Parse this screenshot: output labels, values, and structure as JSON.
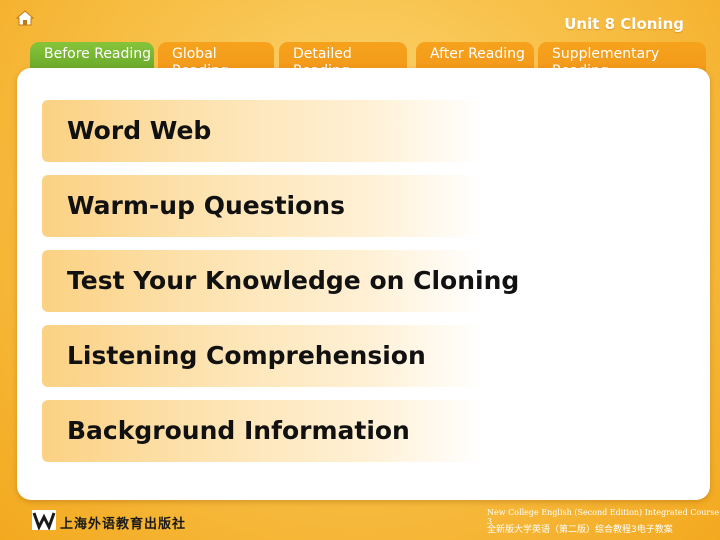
{
  "header": {
    "unit_title": "Unit 8 Cloning"
  },
  "tabs": [
    {
      "label": "Before Reading",
      "active": true
    },
    {
      "label": "Global Reading",
      "active": false
    },
    {
      "label": "Detailed Reading",
      "active": false
    },
    {
      "label": "After Reading",
      "active": false
    },
    {
      "label": "Supplementary Reading",
      "active": false
    }
  ],
  "menu": {
    "items": [
      {
        "label": "Word Web"
      },
      {
        "label": "Warm-up Questions"
      },
      {
        "label": "Test Your Knowledge on Cloning"
      },
      {
        "label": "Listening Comprehension"
      },
      {
        "label": "Background Information"
      }
    ]
  },
  "footer": {
    "publisher": "上海外语教育出版社",
    "course_en": "New College English (Second Edition) Integrated Course 3",
    "course_cn": "全新版大学英语（第二版）综合教程3电子教案"
  },
  "colors": {
    "background": "#f8c24c",
    "tab": "#f6a21c",
    "tab_active": "#6fae2c",
    "item_fill": "#fbd183"
  },
  "icons": {
    "home": "home-icon",
    "logo": "publisher-logo-icon"
  }
}
